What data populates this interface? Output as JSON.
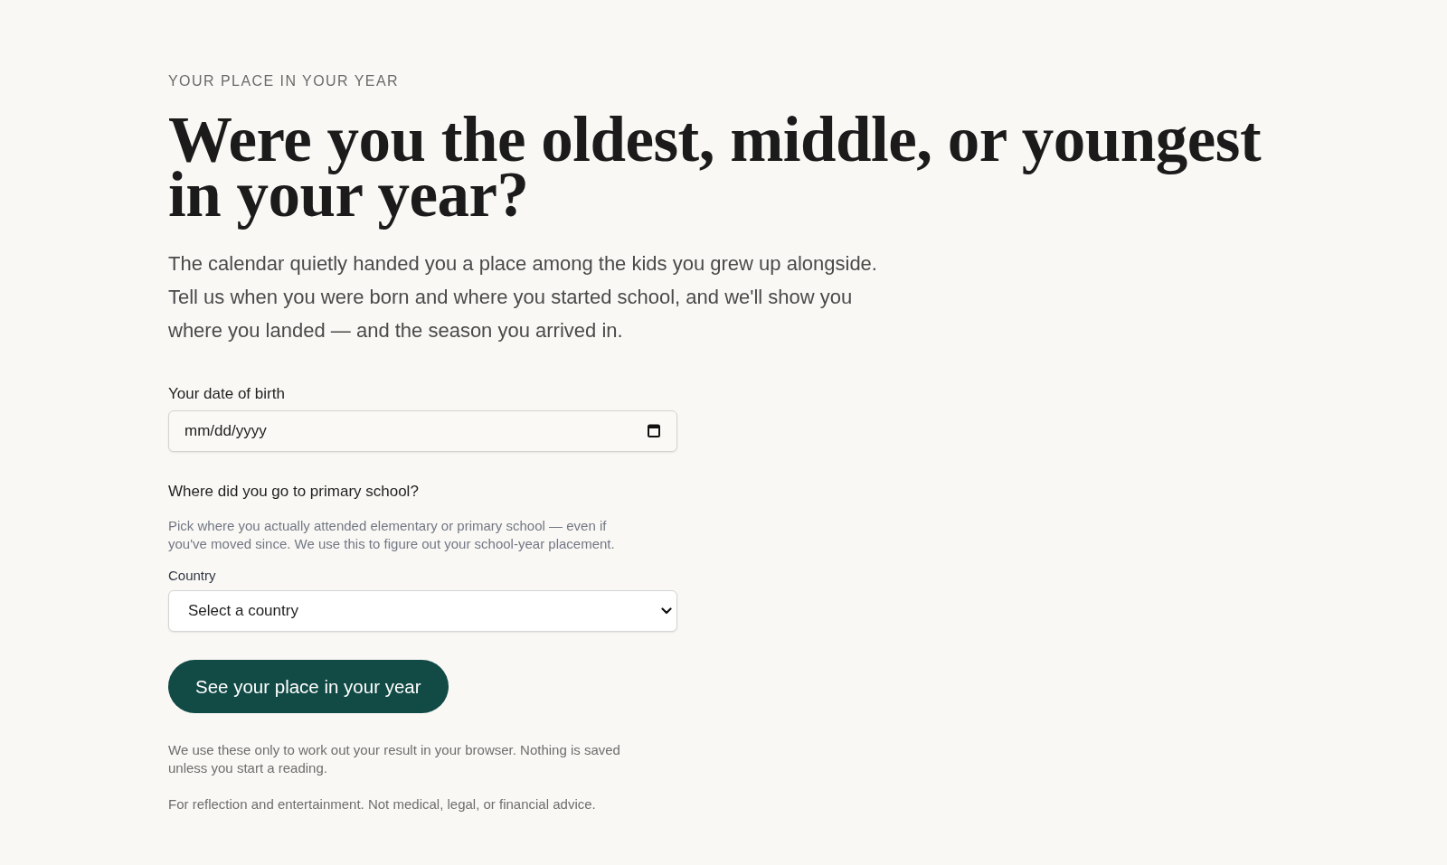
{
  "header": {
    "eyebrow": "YOUR PLACE IN YOUR YEAR",
    "title": "Were you the oldest, middle, or youngest in your year?",
    "intro": "The calendar quietly handed you a place among the kids you grew up alongside. Tell us when you were born and where you started school, and we'll show you where you landed — and the season you arrived in."
  },
  "form": {
    "date_of_birth": {
      "label": "Your date of birth",
      "placeholder": "mm/dd/yyyy"
    },
    "school": {
      "question": "Where did you go to primary school?",
      "help": "Pick where you actually attended elementary or primary school — even if you've moved since. We use this to figure out your school-year placement.",
      "country": {
        "label": "Country",
        "value": "Select a country"
      }
    },
    "submit": "See your place in your year"
  },
  "notes": [
    "We use these only to work out your result in your browser. Nothing is saved unless you start a reading.",
    "For reflection and entertainment. Not medical, legal, or financial advice."
  ]
}
